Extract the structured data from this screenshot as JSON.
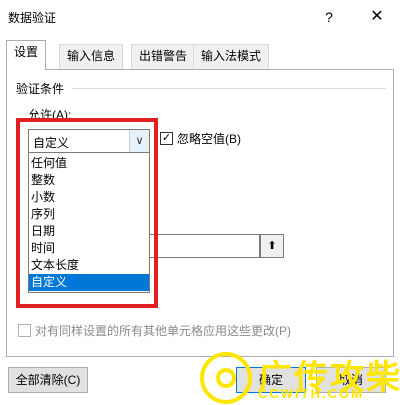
{
  "window": {
    "title": "数据验证",
    "help_glyph": "?",
    "close_glyph": "✕"
  },
  "tabs": [
    {
      "label": "设置"
    },
    {
      "label": "输入信息"
    },
    {
      "label": "出错警告"
    },
    {
      "label": "输入法模式"
    }
  ],
  "validation": {
    "section_title": "验证条件",
    "allow_label": "允许(A):",
    "allow_value": "自定义",
    "ignore_blank": "忽略空值(B)",
    "ignore_blank_checked": true,
    "options": [
      "任何值",
      "整数",
      "小数",
      "序列",
      "日期",
      "时间",
      "文本长度",
      "自定义"
    ],
    "selected_option": "自定义"
  },
  "apply_all": "对有同样设置的所有其他单元格应用这些更改(P)",
  "buttons": {
    "clear": "全部清除(C)",
    "ok": "确定",
    "cancel": "取消"
  },
  "watermark": {
    "text": "广传攻柴",
    "url": "CCWITH.COM"
  },
  "colors": {
    "highlight": "#e02020",
    "selection": "#0078d7",
    "watermark": "#ffe600"
  }
}
